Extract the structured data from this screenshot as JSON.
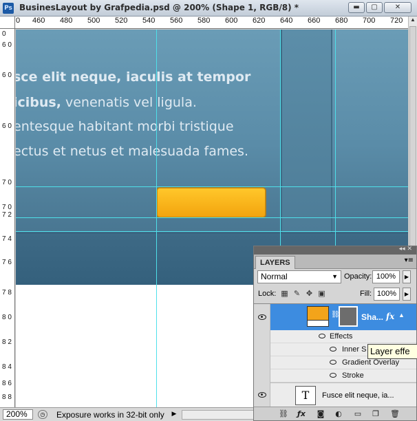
{
  "window": {
    "app_icon": "Ps",
    "title": "BusinesLayout by Grafpedia.psd @ 200% (Shape 1, RGB/8) *",
    "min_label": "▬",
    "max_label": "▢",
    "close_label": "✕"
  },
  "ruler": {
    "top_labels": [
      "0",
      "460",
      "480",
      "500",
      "520",
      "540",
      "560",
      "580",
      "600",
      "620",
      "640",
      "660",
      "680",
      "700",
      "720"
    ],
    "left_labels": [
      "0",
      "6 0",
      "6 0",
      "6 0",
      "7 0",
      "7 0",
      "7 2",
      "7 4",
      "7 6",
      "7 8",
      "8 0",
      "8 2",
      "8 4",
      "8 6",
      "8 8"
    ]
  },
  "canvas": {
    "text_lines": [
      {
        "text": "sce elit neque, iaculis at tempor",
        "bold": true
      },
      {
        "text": "icibus, venenatis vel ligula.",
        "bold_prefix": "icibus,"
      },
      {
        "text": "entesque habitant morbi tristique",
        "bold": false
      },
      {
        "text": "ectus et netus et malesuada fames.",
        "bold": false
      }
    ],
    "line1": "sce elit neque, iaculis at tempor",
    "line2_bold": "icibus,",
    "line2_rest": " venenatis vel ligula.",
    "line3": "entesque habitant morbi tristique",
    "line4": "ectus et netus et malesuada fames.",
    "button_color": "#f7b21b",
    "bg_color": "#5a8ca8",
    "guide_color": "#4ee0ea"
  },
  "status": {
    "zoom": "200%",
    "message": "Exposure works in 32-bit only",
    "arrow": "▶"
  },
  "layers_panel": {
    "tab": "LAYERS",
    "blend_mode": "Normal",
    "opacity_label": "Opacity:",
    "opacity_value": "100%",
    "lock_label": "Lock:",
    "fill_label": "Fill:",
    "fill_value": "100%",
    "shape_layer": {
      "name": "Sha...",
      "fx": "fx"
    },
    "effects_label": "Effects",
    "effects": [
      "Inner S",
      "Gradient Overlay",
      "Stroke"
    ],
    "text_layer": {
      "thumb": "T",
      "name": "Fusce elit neque, ia..."
    },
    "tooltip": "Layer effe",
    "footer_icons": [
      "link-icon",
      "fx-icon",
      "mask-icon",
      "adjustment-icon",
      "group-icon",
      "new-layer-icon",
      "trash-icon"
    ]
  }
}
